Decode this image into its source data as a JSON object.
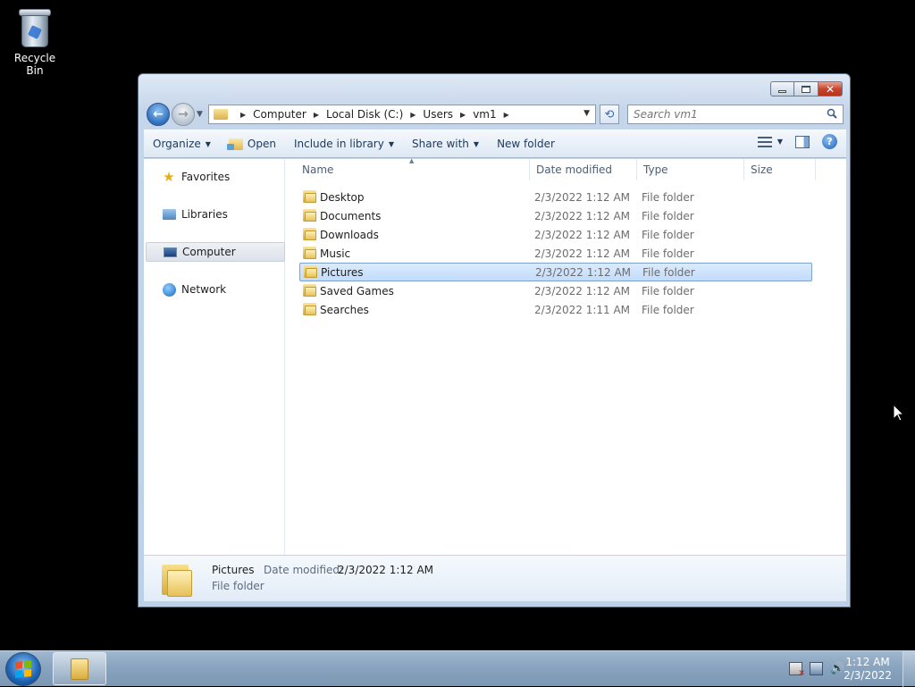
{
  "desktop": {
    "recycle_bin_label": "Recycle Bin"
  },
  "window": {
    "address": {
      "crumbs": [
        "Computer",
        "Local Disk (C:)",
        "Users",
        "vm1"
      ]
    },
    "search": {
      "placeholder": "Search vm1"
    },
    "toolbar": {
      "organize": "Organize",
      "open": "Open",
      "include_in_library": "Include in library",
      "share_with": "Share with",
      "new_folder": "New folder"
    },
    "nav_pane": {
      "items": [
        {
          "label": "Favorites",
          "icon": "star-icon"
        },
        {
          "label": "Libraries",
          "icon": "libraries-icon"
        },
        {
          "label": "Computer",
          "icon": "computer-icon"
        },
        {
          "label": "Network",
          "icon": "network-icon"
        }
      ],
      "selected_index": 2
    },
    "columns": [
      "Name",
      "Date modified",
      "Type",
      "Size"
    ],
    "files": [
      {
        "name": "Desktop",
        "date": "2/3/2022 1:12 AM",
        "type": "File folder"
      },
      {
        "name": "Documents",
        "date": "2/3/2022 1:12 AM",
        "type": "File folder"
      },
      {
        "name": "Downloads",
        "date": "2/3/2022 1:12 AM",
        "type": "File folder"
      },
      {
        "name": "Music",
        "date": "2/3/2022 1:12 AM",
        "type": "File folder"
      },
      {
        "name": "Pictures",
        "date": "2/3/2022 1:12 AM",
        "type": "File folder"
      },
      {
        "name": "Saved Games",
        "date": "2/3/2022 1:12 AM",
        "type": "File folder"
      },
      {
        "name": "Searches",
        "date": "2/3/2022 1:11 AM",
        "type": "File folder"
      }
    ],
    "selected_file_index": 4,
    "details": {
      "name": "Pictures",
      "date_label": "Date modified:",
      "date_value": "2/3/2022 1:12 AM",
      "type": "File folder"
    }
  },
  "taskbar": {
    "clock_time": "1:12 AM",
    "clock_date": "2/3/2022"
  },
  "colors": {
    "selection_fill": "#c1dcfc",
    "selection_border": "#7da2ce",
    "taskbar": "#8aa4bf"
  }
}
